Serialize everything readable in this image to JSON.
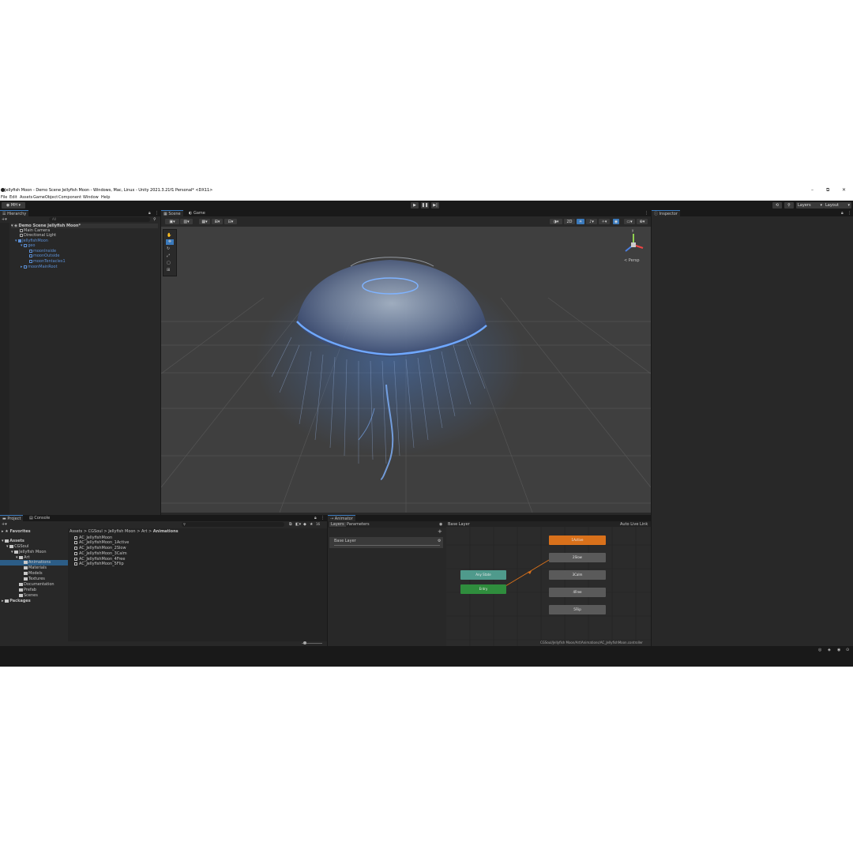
{
  "window": {
    "title": "Jellyfish Moon - Demo Scene Jellyfish Moon - Windows, Mac, Linux - Unity 2021.3.21f1 Personal* <DX11>",
    "controls": {
      "minimize": "–",
      "maximize": "⧉",
      "close": "✕"
    }
  },
  "menu": [
    "File",
    "Edit",
    "Assets",
    "GameObject",
    "Component",
    "Window",
    "Help"
  ],
  "toolbar": {
    "account": "MH",
    "play": "▶",
    "pause": "❚❚",
    "step": "▶|",
    "layers": "Layers",
    "layout": "Layout"
  },
  "hierarchy": {
    "tab": "Hierarchy",
    "search_placeholder": "All",
    "items": [
      {
        "label": "Demo Scene Jellyfish Moon*",
        "level": 0
      },
      {
        "label": "Main Camera",
        "level": 1
      },
      {
        "label": "Directional Light",
        "level": 1
      },
      {
        "label": "JellyfishMoon",
        "level": 1
      },
      {
        "label": "geo",
        "level": 2
      },
      {
        "label": "moonInside",
        "level": 3
      },
      {
        "label": "moonOutside",
        "level": 3
      },
      {
        "label": "moonTentacles1",
        "level": 3
      },
      {
        "label": "moonMainRoot",
        "level": 2
      }
    ]
  },
  "scene": {
    "tabs": [
      "Scene",
      "Game"
    ],
    "mode_2d": "2D",
    "persp_label": "< Persp",
    "gizmo_axes": {
      "y": "y",
      "x": "x",
      "z": "z"
    }
  },
  "inspector": {
    "tab": "Inspector"
  },
  "project": {
    "tabs": [
      "Project",
      "Console"
    ],
    "tree": [
      {
        "label": "Favorites",
        "indent": 0
      },
      {
        "label": "Assets",
        "indent": 0
      },
      {
        "label": "CGSoul",
        "indent": 1
      },
      {
        "label": "Jellyfish Moon",
        "indent": 2
      },
      {
        "label": "Art",
        "indent": 3
      },
      {
        "label": "Animations",
        "indent": 4,
        "selected": true
      },
      {
        "label": "Materials",
        "indent": 4
      },
      {
        "label": "Models",
        "indent": 4
      },
      {
        "label": "Textures",
        "indent": 4
      },
      {
        "label": "Documentation",
        "indent": 3
      },
      {
        "label": "Prefab",
        "indent": 3
      },
      {
        "label": "Scenes",
        "indent": 3
      },
      {
        "label": "Packages",
        "indent": 0
      }
    ],
    "breadcrumb": [
      "Assets",
      "CGSoul",
      "Jellyfish Moon",
      "Art",
      "Animations"
    ],
    "files": [
      "AC_JellyfishMoon",
      "AC_JellyfishMoon_1Active",
      "AC_JellyfishMoon_2Slow",
      "AC_JellyfishMoon_3Calm",
      "AC_JellyfishMoon_4Free",
      "AC_JellyfishMoon_5Flip"
    ],
    "badge": "16"
  },
  "animator": {
    "tab": "Animator",
    "subtabs": [
      "Layers",
      "Parameters"
    ],
    "layer": "Base Layer",
    "breadcrumb": "Base Layer",
    "auto_live_link": "Auto Live Link",
    "path": "CGSoul/Jellyfish Moon/Art/Animations/AC_JellyfishMoon.controller",
    "states": [
      {
        "label": "1Active",
        "kind": "default",
        "color": "#d9711b"
      },
      {
        "label": "2Slow",
        "kind": "normal",
        "color": "#5a5a5a"
      },
      {
        "label": "3Calm",
        "kind": "normal",
        "color": "#5a5a5a"
      },
      {
        "label": "4Free",
        "kind": "normal",
        "color": "#5a5a5a"
      },
      {
        "label": "5Flip",
        "kind": "normal",
        "color": "#5a5a5a"
      },
      {
        "label": "Any State",
        "kind": "any",
        "color": "#4f9a8c"
      },
      {
        "label": "Entry",
        "kind": "entry",
        "color": "#2f8d3d"
      }
    ]
  },
  "colors": {
    "accent_blue": "#3a79bb",
    "panel": "#282828",
    "background": "#191919",
    "selection": "#2c5d87"
  }
}
